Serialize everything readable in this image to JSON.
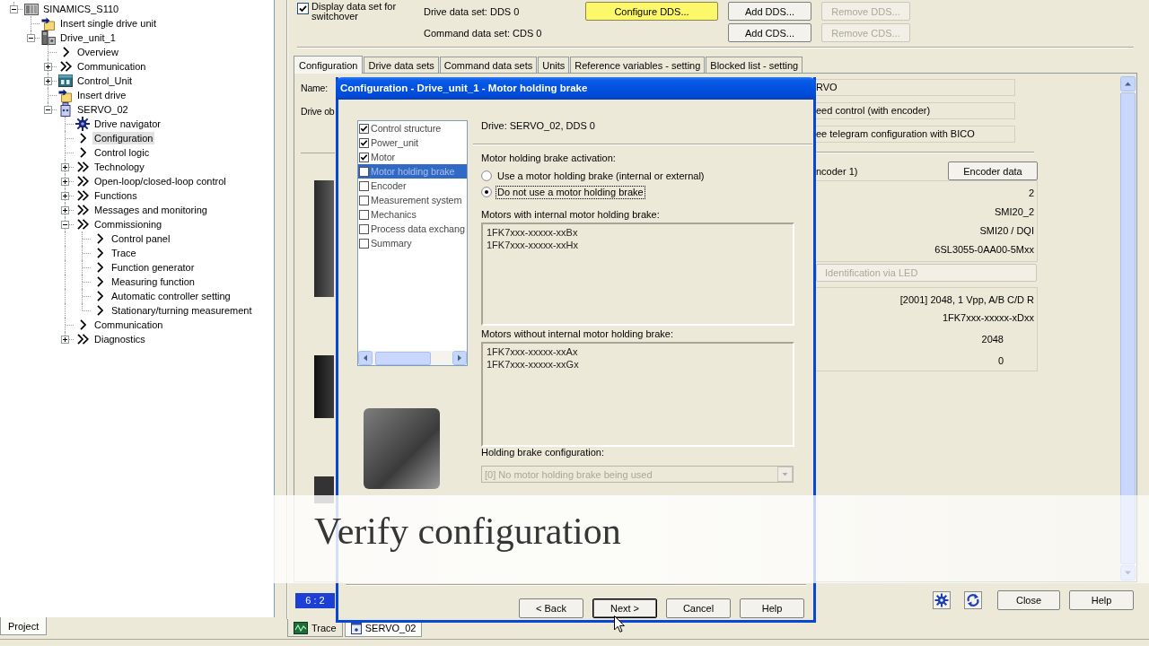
{
  "project_tree": {
    "items": [
      {
        "label": "SINAMICS_S110",
        "kind": "device",
        "expanded": true,
        "selected": false,
        "children": [
          {
            "label": "Insert single drive unit",
            "kind": "insert",
            "selected": false
          },
          {
            "label": "Drive_unit_1",
            "kind": "drive-unit",
            "expanded": true,
            "selected": false,
            "children": [
              {
                "label": "Overview",
                "kind": "single",
                "selected": false
              },
              {
                "label": "Communication",
                "kind": "double",
                "expanded": false,
                "selected": false
              },
              {
                "label": "Control_Unit",
                "kind": "cu",
                "expanded": false,
                "selected": false
              },
              {
                "label": "Insert drive",
                "kind": "insert",
                "selected": false
              },
              {
                "label": "SERVO_02",
                "kind": "servo",
                "expanded": true,
                "selected": false,
                "children": [
                  {
                    "label": "Drive navigator",
                    "kind": "navigator",
                    "selected": false
                  },
                  {
                    "label": "Configuration",
                    "kind": "single",
                    "selected": true
                  },
                  {
                    "label": "Control logic",
                    "kind": "single",
                    "selected": false
                  },
                  {
                    "label": "Technology",
                    "kind": "double",
                    "expanded": false,
                    "selected": false
                  },
                  {
                    "label": "Open-loop/closed-loop control",
                    "kind": "double",
                    "expanded": false,
                    "selected": false
                  },
                  {
                    "label": "Functions",
                    "kind": "double",
                    "expanded": false,
                    "selected": false
                  },
                  {
                    "label": "Messages and monitoring",
                    "kind": "double",
                    "expanded": false,
                    "selected": false
                  },
                  {
                    "label": "Commissioning",
                    "kind": "double",
                    "expanded": true,
                    "selected": false,
                    "children": [
                      {
                        "label": "Control panel",
                        "kind": "single",
                        "selected": false
                      },
                      {
                        "label": "Trace",
                        "kind": "single",
                        "selected": false
                      },
                      {
                        "label": "Function generator",
                        "kind": "single",
                        "selected": false
                      },
                      {
                        "label": "Measuring function",
                        "kind": "single",
                        "selected": false
                      },
                      {
                        "label": "Automatic controller setting",
                        "kind": "single",
                        "selected": false
                      },
                      {
                        "label": "Stationary/turning measurement",
                        "kind": "single",
                        "selected": false
                      }
                    ]
                  },
                  {
                    "label": "Communication",
                    "kind": "single",
                    "selected": false
                  },
                  {
                    "label": "Diagnostics",
                    "kind": "double",
                    "expanded": false,
                    "selected": false
                  }
                ]
              }
            ]
          }
        ]
      }
    ]
  },
  "pane_tabs": [
    {
      "label": "Project",
      "selected": true
    }
  ],
  "data_sets": {
    "switchover": {
      "label": "Display data set for switchover",
      "checked": true
    },
    "rows": [
      {
        "label": "Drive data set: DDS 0",
        "buttons": [
          {
            "label": "Configure DDS...",
            "highlighted": true,
            "disabled": false
          },
          {
            "label": "Add DDS...",
            "highlighted": false,
            "disabled": false
          },
          {
            "label": "Remove DDS...",
            "highlighted": false,
            "disabled": true
          }
        ]
      },
      {
        "label": "Command data set: CDS 0",
        "buttons": [
          {
            "label": "Add CDS...",
            "highlighted": false,
            "disabled": false
          },
          {
            "label": "Remove CDS...",
            "highlighted": false,
            "disabled": true
          }
        ]
      }
    ]
  },
  "tabs": [
    {
      "label": "Configuration",
      "selected": true
    },
    {
      "label": "Drive data sets",
      "selected": false
    },
    {
      "label": "Command data sets",
      "selected": false
    },
    {
      "label": "Units",
      "selected": false
    },
    {
      "label": "Reference variables - setting",
      "selected": false
    },
    {
      "label": "Blocked list - setting",
      "selected": false
    }
  ],
  "configuration": {
    "name_label": "Name:",
    "drive_object_label": "Drive ob",
    "fields": [
      "RVO",
      "eed control (with encoder)",
      "ee telegram configuration with BICO"
    ],
    "encoder": {
      "label": "ncoder 1)",
      "button": "Encoder data",
      "values": [
        "2",
        "SMI20_2",
        "SMI20 / DQI",
        "6SL3055-0AA00-5Mxx"
      ]
    },
    "identification_button": {
      "label": "Identification via LED",
      "disabled": true
    },
    "motor_encoder": {
      "values": [
        "[2001] 2048, 1 Vpp, A/B C/D R",
        "1FK7xxx-xxxxx-xDxx"
      ],
      "counts": [
        "2048",
        "0"
      ]
    }
  },
  "page_indicator": "6 : 2",
  "window_buttons": [
    "Close",
    "Help"
  ],
  "window_tabs": [
    {
      "label": "Trace",
      "kind": "trace",
      "selected": false
    },
    {
      "label": "SERVO_02",
      "kind": "window",
      "selected": true
    }
  ],
  "dialog": {
    "title": "Configuration - Drive_unit_1 - Motor holding brake",
    "steps": [
      {
        "label": "Control structure",
        "checked": true,
        "selected": false
      },
      {
        "label": "Power_unit",
        "checked": true,
        "selected": false
      },
      {
        "label": "Motor",
        "checked": true,
        "selected": false
      },
      {
        "label": "Motor holding brake",
        "checked": false,
        "selected": true
      },
      {
        "label": "Encoder",
        "checked": false,
        "selected": false
      },
      {
        "label": "Measurement system",
        "checked": false,
        "selected": false
      },
      {
        "label": "Mechanics",
        "checked": false,
        "selected": false
      },
      {
        "label": "Process data exchang",
        "checked": false,
        "selected": false
      },
      {
        "label": "Summary",
        "checked": false,
        "selected": false
      }
    ],
    "drive": "Drive: SERVO_02, DDS 0",
    "activation_label": "Motor holding brake activation:",
    "options": [
      {
        "label": "Use a motor holding brake (internal or external)",
        "selected": false
      },
      {
        "label": "Do not use a motor holding brake",
        "selected": true
      }
    ],
    "with_brake": {
      "label": "Motors with internal motor holding brake:",
      "items": [
        "1FK7xxx-xxxxx-xxBx",
        "1FK7xxx-xxxxx-xxHx"
      ]
    },
    "without_brake": {
      "label": "Motors without internal motor holding brake:",
      "items": [
        "1FK7xxx-xxxxx-xxAx",
        "1FK7xxx-xxxxx-xxGx"
      ]
    },
    "brake_configuration": {
      "label": "Holding brake configuration:",
      "value": "[0] No motor holding brake being used",
      "disabled": true
    },
    "buttons": [
      {
        "label": "< Back",
        "default": false
      },
      {
        "label": "Next >",
        "default": true
      },
      {
        "label": "Cancel",
        "default": false
      },
      {
        "label": "Help",
        "default": false
      }
    ]
  },
  "caption": "Verify configuration"
}
